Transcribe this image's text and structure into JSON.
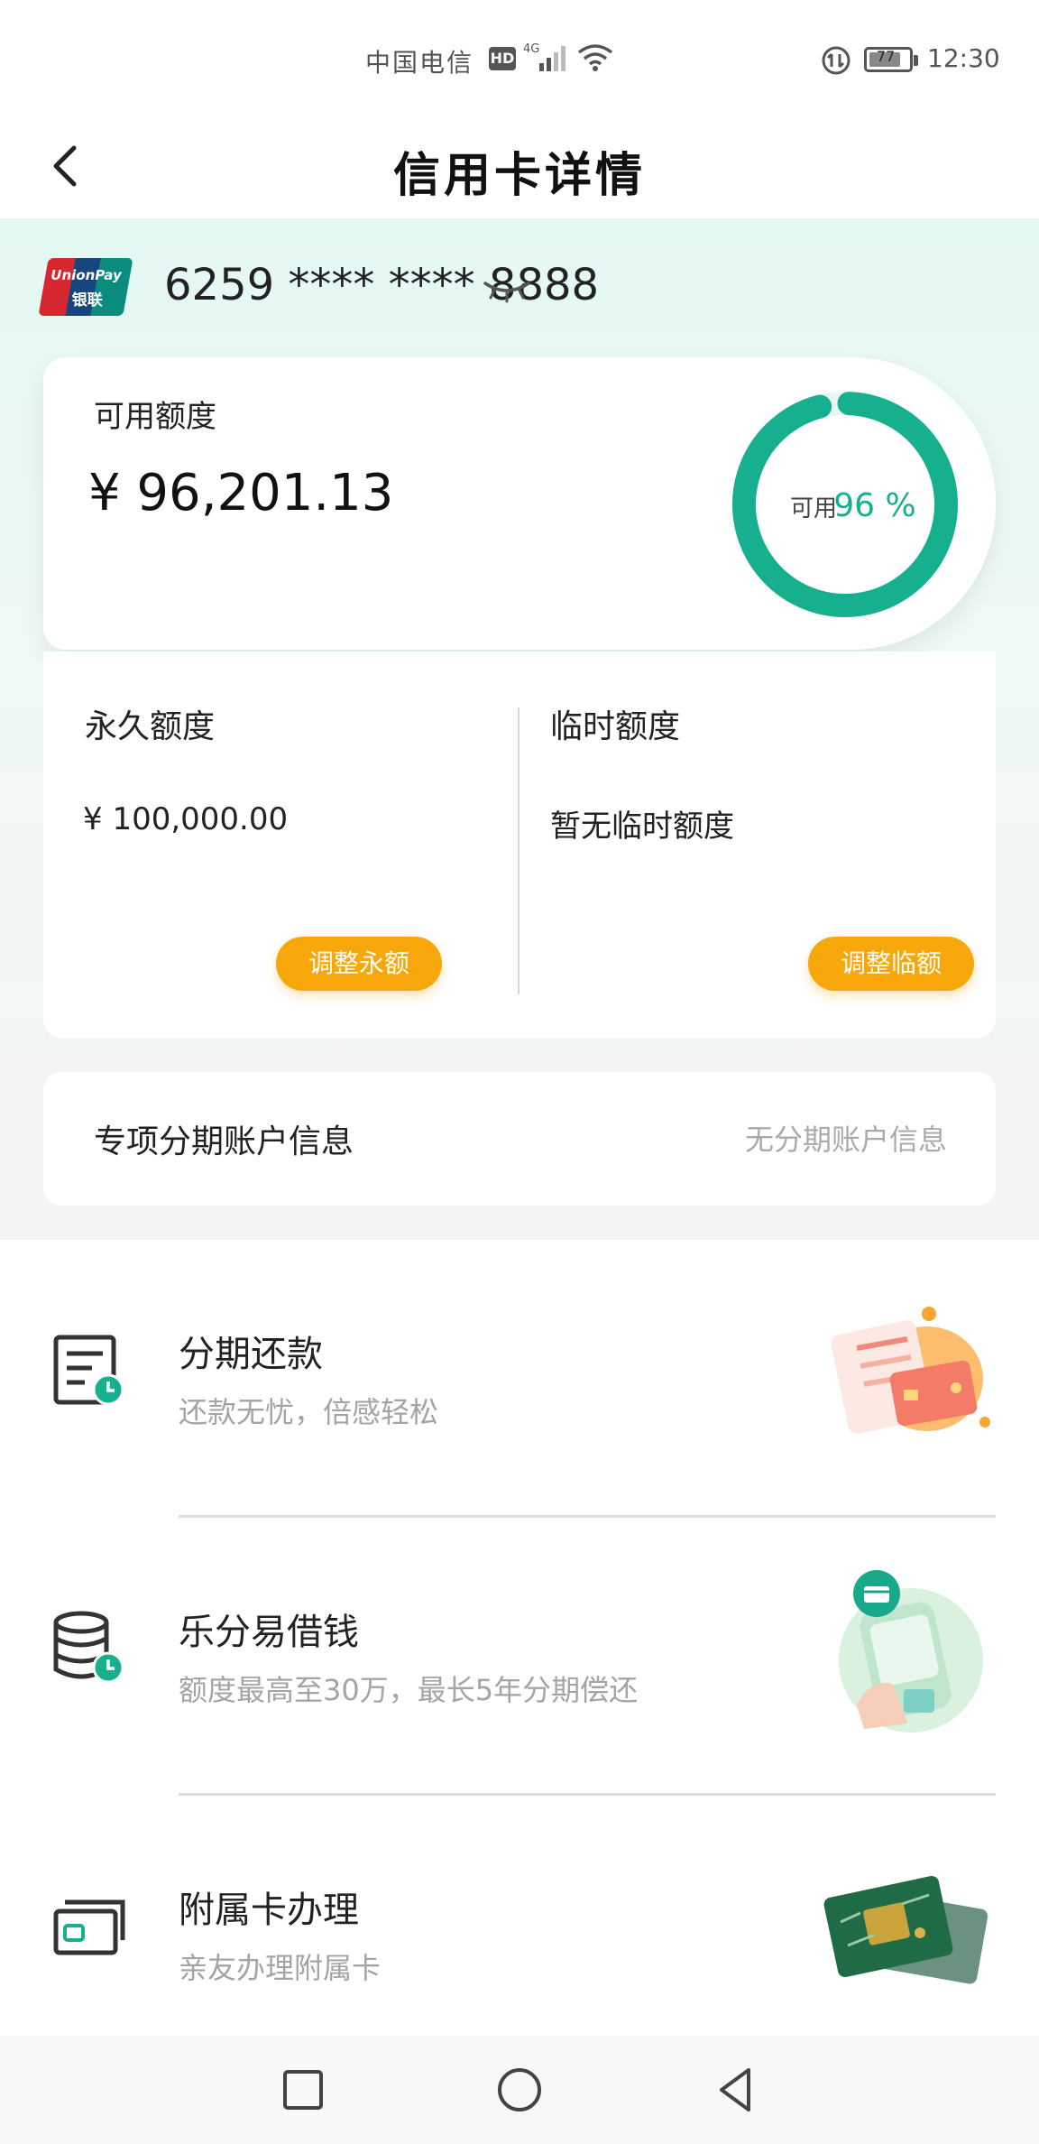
{
  "status_bar": {
    "carrier": "中国电信",
    "hd_badge": "HD",
    "network": "4G",
    "battery": "77",
    "time": "12:30"
  },
  "header": {
    "title": "信用卡详情"
  },
  "card": {
    "number": "6259 **** **** 8888",
    "brand_en": "UnionPay",
    "brand_cn": "银联"
  },
  "available": {
    "label": "可用额度",
    "amount": "¥ 96,201.13",
    "ring_label": "可用",
    "percent_value": 96,
    "percent_text": "96 %"
  },
  "limits": {
    "permanent": {
      "title": "永久额度",
      "value": "¥ 100,000.00",
      "button": "调整永额"
    },
    "temporary": {
      "title": "临时额度",
      "value": "暂无临时额度",
      "button": "调整临额"
    }
  },
  "installment_account": {
    "label": "专项分期账户信息",
    "value": "无分期账户信息"
  },
  "services": [
    {
      "title": "分期还款",
      "subtitle": "还款无忧，倍感轻松",
      "icon": "bill-clock-icon"
    },
    {
      "title": "乐分易借钱",
      "subtitle": "额度最高至30万，最长5年分期偿还",
      "icon": "coins-clock-icon"
    },
    {
      "title": "附属卡办理",
      "subtitle": "亲友办理附属卡",
      "icon": "card-stack-icon"
    }
  ],
  "colors": {
    "accent_teal": "#16b08f",
    "button_orange": "#f8a70a",
    "bg_teal": "#e4f8f4"
  }
}
